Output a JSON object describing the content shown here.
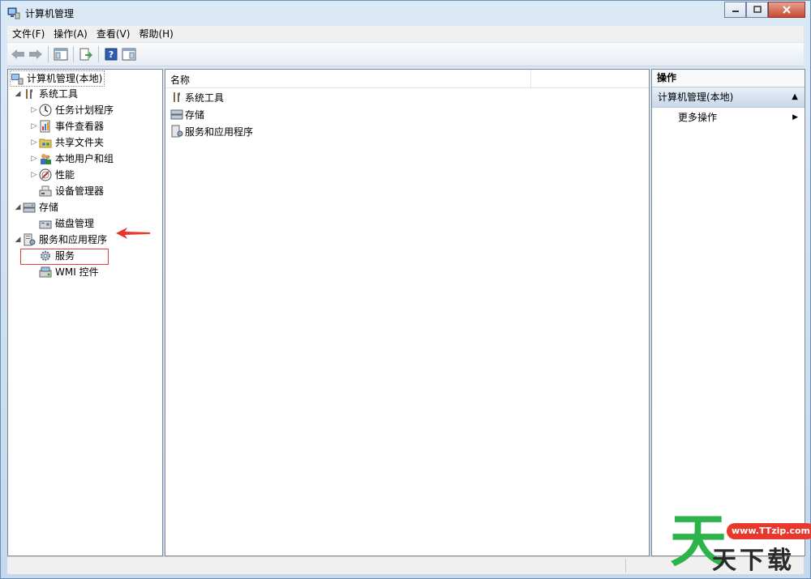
{
  "window": {
    "title": "计算机管理"
  },
  "menu": [
    {
      "label": "文件(F)"
    },
    {
      "label": "操作(A)"
    },
    {
      "label": "查看(V)"
    },
    {
      "label": "帮助(H)"
    }
  ],
  "tree": {
    "root": "计算机管理(本地)",
    "system_tools": "系统工具",
    "task_scheduler": "任务计划程序",
    "event_viewer": "事件查看器",
    "shared_folders": "共享文件夹",
    "local_users": "本地用户和组",
    "performance": "性能",
    "device_manager": "设备管理器",
    "storage": "存储",
    "disk_management": "磁盘管理",
    "services_apps": "服务和应用程序",
    "services": "服务",
    "wmi": "WMI 控件"
  },
  "list": {
    "column_name": "名称",
    "rows": [
      "系统工具",
      "存储",
      "服务和应用程序"
    ]
  },
  "actions": {
    "header": "操作",
    "group": "计算机管理(本地)",
    "more": "更多操作"
  },
  "watermark": {
    "big": "天",
    "url": "www.TTzip.com",
    "small": "天下载"
  },
  "colors": {
    "accent_red": "#e0413a",
    "watermark_green": "#2cb34a"
  }
}
